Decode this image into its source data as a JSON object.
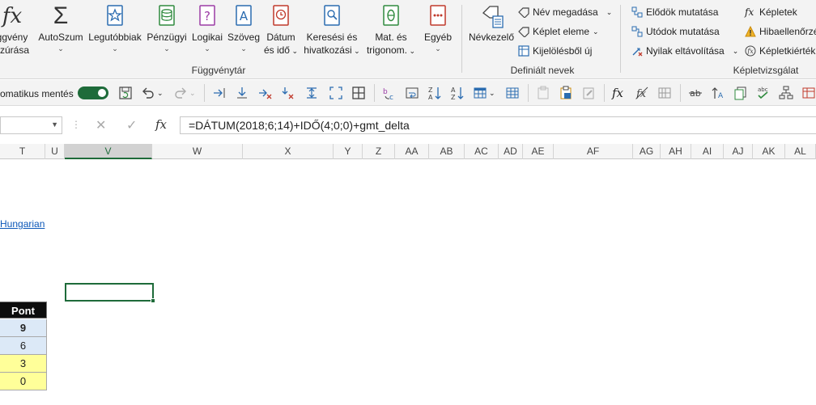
{
  "ribbon": {
    "functions_group": {
      "label": "Függvénytár",
      "insert_fn": [
        "ggvény",
        "szúrása"
      ],
      "autosum": "AutoSzum",
      "recent": "Legutóbbiak",
      "financial": "Pénzügyi",
      "logical": "Logikai",
      "text": "Szöveg",
      "datetime": [
        "Dátum",
        "és idő"
      ],
      "lookup": [
        "Keresési és",
        "hivatkozási"
      ],
      "math": [
        "Mat. és",
        "trigonom."
      ],
      "more": "Egyéb"
    },
    "names_group": {
      "label": "Definiált nevek",
      "manager": "Névkezelő",
      "define_name": "Név megadása",
      "use_in_formula": "Képlet eleme",
      "create_from_selection": "Kijelölésből új"
    },
    "audit_group": {
      "label": "Képletvizsgálat",
      "trace_precedents": "Elődök mutatása",
      "trace_dependents": "Utódok mutatása",
      "remove_arrows": "Nyilak eltávolítása",
      "show_formulas": "Képletek",
      "error_checking": "Hibaellenőrzé",
      "evaluate": "Képletkiérték"
    }
  },
  "qat": {
    "autosave_label": "omatikus mentés"
  },
  "formula_bar": {
    "fx": "fx",
    "formula": "=DÁTUM(2018;6;14)+IDŐ(4;0;0)+gmt_delta"
  },
  "columns": [
    "T",
    "U",
    "V",
    "W",
    "X",
    "Y",
    "Z",
    "AA",
    "AB",
    "AC",
    "AD",
    "AE",
    "AF",
    "AG",
    "AH",
    "AI",
    "AJ",
    "AK",
    "AL"
  ],
  "selected_column": "V",
  "grid": {
    "link_text": "Hungarian",
    "table": {
      "header": "Pont",
      "values": [
        "9",
        "6",
        "3",
        "0"
      ]
    }
  },
  "colors": {
    "accent": "#1e6b3a",
    "link": "#0b57b8",
    "row_blue": "#dce9f7",
    "row_yellow": "#ffff99"
  }
}
